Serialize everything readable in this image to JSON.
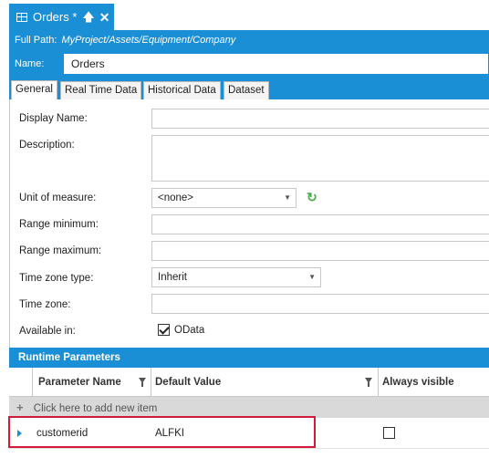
{
  "tab": {
    "title": "Orders *",
    "pin_icon": "pin-icon",
    "close_icon": "close-icon"
  },
  "header": {
    "full_path_label": "Full Path:",
    "full_path_value": "MyProject/Assets/Equipment/Company",
    "name_label": "Name:",
    "name_value": "Orders"
  },
  "prop_tabs": [
    "General",
    "Real Time Data",
    "Historical Data",
    "Dataset"
  ],
  "form": {
    "display_name_label": "Display Name:",
    "description_label": "Description:",
    "unit_label": "Unit of measure:",
    "unit_value": "<none>",
    "range_min_label": "Range minimum:",
    "range_max_label": "Range maximum:",
    "tz_type_label": "Time zone type:",
    "tz_type_value": "Inherit",
    "tz_label": "Time zone:",
    "available_label": "Available in:",
    "available_option": "OData",
    "available_checked": true
  },
  "runtime": {
    "title": "Runtime Parameters",
    "columns": [
      "Parameter Name",
      "Default Value",
      "Always visible"
    ],
    "add_row_text": "Click here to add new item",
    "rows": [
      {
        "name": "customerid",
        "default": "ALFKI",
        "always_visible": false
      }
    ]
  },
  "colors": {
    "accent": "#1a8fd6",
    "highlight": "#d01c3a"
  }
}
